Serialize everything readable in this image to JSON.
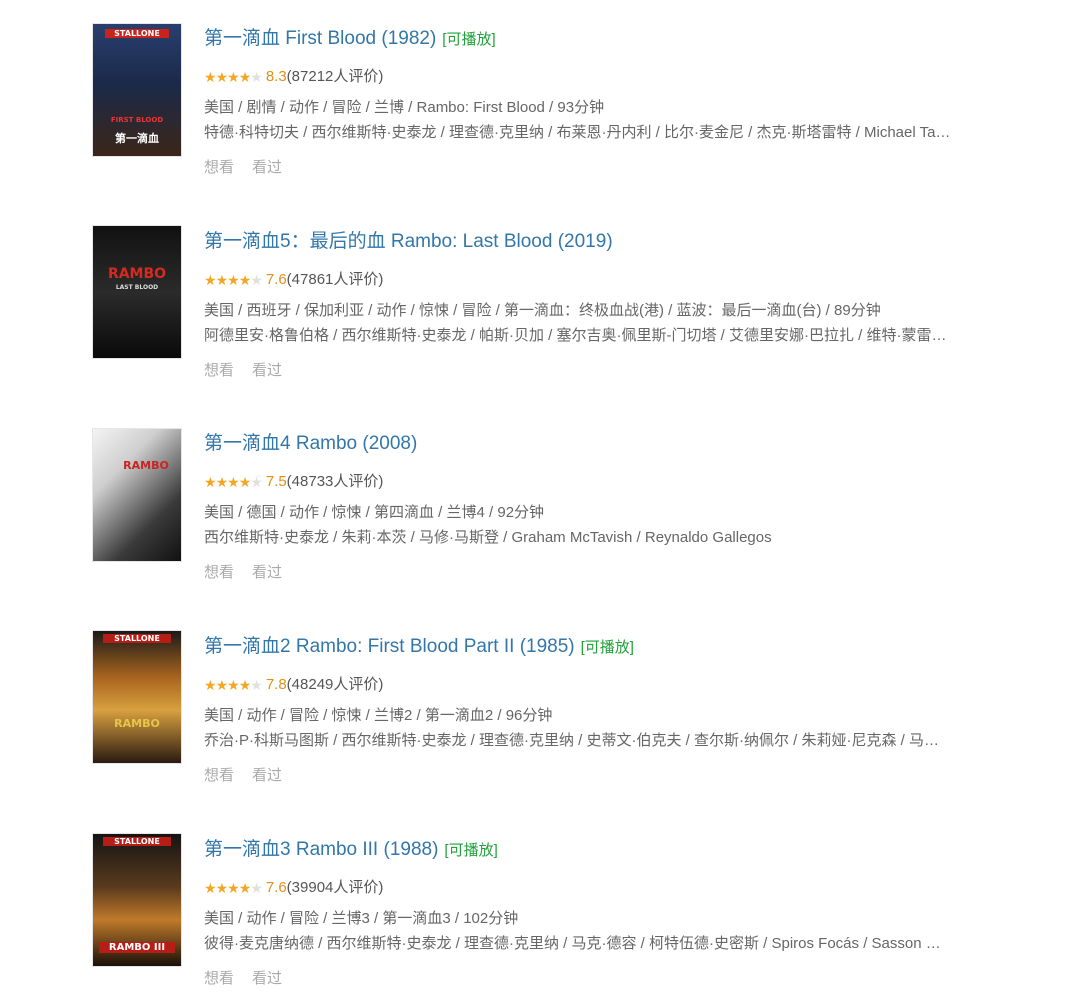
{
  "movies": [
    {
      "title": "第一滴血 First Blood (1982)",
      "playable": "[可播放]",
      "stars": 4,
      "score": "8.3",
      "count": "(87212人评价)",
      "meta": "美国 / 剧情 / 动作 / 冒险 / 兰博 / Rambo: First Blood / 93分钟",
      "cast": "特德·科特切夫 / 西尔维斯特·史泰龙 / 理查德·克里纳 / 布莱恩·丹内利 / 比尔·麦金尼 / 杰克·斯塔雷特 / Michael Ta…",
      "poster": {
        "top_text": "STALLONE",
        "main_text": "FIRST BLOOD",
        "sub_text": "第一滴血"
      }
    },
    {
      "title": "第一滴血5：最后的血 Rambo: Last Blood (2019)",
      "playable": "",
      "stars": 4,
      "score": "7.6",
      "count": "(47861人评价)",
      "meta": "美国 / 西班牙 / 保加利亚 / 动作 / 惊悚 / 冒险 / 第一滴血：终极血战(港) / 蓝波：最后一滴血(台) / 89分钟",
      "cast": "阿德里安·格鲁伯格 / 西尔维斯特·史泰龙 / 帕斯·贝加 / 塞尔吉奥·佩里斯-门切塔 / 艾德里安娜·巴拉扎 / 维特·蒙雷…",
      "poster": {
        "top_text": "",
        "main_text": "RAMBO",
        "sub_text": "LAST BLOOD"
      }
    },
    {
      "title": "第一滴血4 Rambo (2008)",
      "playable": "",
      "stars": 4,
      "score": "7.5",
      "count": "(48733人评价)",
      "meta": "美国 / 德国 / 动作 / 惊悚 / 第四滴血 / 兰博4 / 92分钟",
      "cast": "西尔维斯特·史泰龙 / 朱莉·本茨 / 马修·马斯登 / Graham McTavish / Reynaldo Gallegos",
      "poster": {
        "top_text": "",
        "main_text": "RAMBO",
        "sub_text": ""
      }
    },
    {
      "title": "第一滴血2 Rambo: First Blood Part II (1985)",
      "playable": "[可播放]",
      "stars": 4,
      "score": "7.8",
      "count": "(48249人评价)",
      "meta": "美国 / 动作 / 冒险 / 惊悚 / 兰博2 / 第一滴血2 / 96分钟",
      "cast": "乔治·P·科斯马图斯 / 西尔维斯特·史泰龙 / 理查德·克里纳 / 史蒂文·伯克夫 / 查尔斯·纳佩尔 / 朱莉娅·尼克森 / 马…",
      "poster": {
        "top_text": "STALLONE",
        "main_text": "RAMBO",
        "sub_text": ""
      }
    },
    {
      "title": "第一滴血3 Rambo III (1988)",
      "playable": "[可播放]",
      "stars": 4,
      "score": "7.6",
      "count": "(39904人评价)",
      "meta": "美国 / 动作 / 冒险 / 兰博3 / 第一滴血3 / 102分钟",
      "cast": "彼得·麦克唐纳德 / 西尔维斯特·史泰龙 / 理查德·克里纳 / 马克·德容 / 柯特伍德·史密斯 / Spiros Focás / Sasson …",
      "poster": {
        "top_text": "STALLONE",
        "main_text": "RAMBO III",
        "sub_text": ""
      }
    }
  ],
  "actions": {
    "want": "想看",
    "seen": "看过"
  },
  "colors": {
    "link": "#3377aa",
    "playable": "#22a23a",
    "star": "#f5a623",
    "score": "#e09015",
    "meta": "#666666",
    "muted": "#aaaaaa"
  },
  "icons": {
    "star_filled": "star-icon",
    "star_empty": "star-empty-icon"
  }
}
